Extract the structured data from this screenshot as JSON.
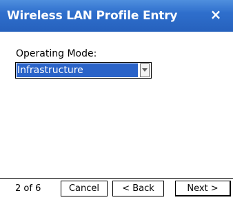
{
  "window": {
    "title": "Wireless LAN Profile Entry",
    "close_label": "×"
  },
  "form": {
    "operating_mode_label": "Operating Mode:",
    "operating_mode_value": "Infrastructure"
  },
  "footer": {
    "page_indicator": "2 of 6",
    "cancel_label": "Cancel",
    "back_label": "< Back",
    "next_label": "Next >"
  },
  "colors": {
    "titlebar": "#2f6fcc",
    "selection": "#2a63c8"
  },
  "icons": {
    "close": "close-icon",
    "dropdown": "dropdown-arrow-icon"
  }
}
